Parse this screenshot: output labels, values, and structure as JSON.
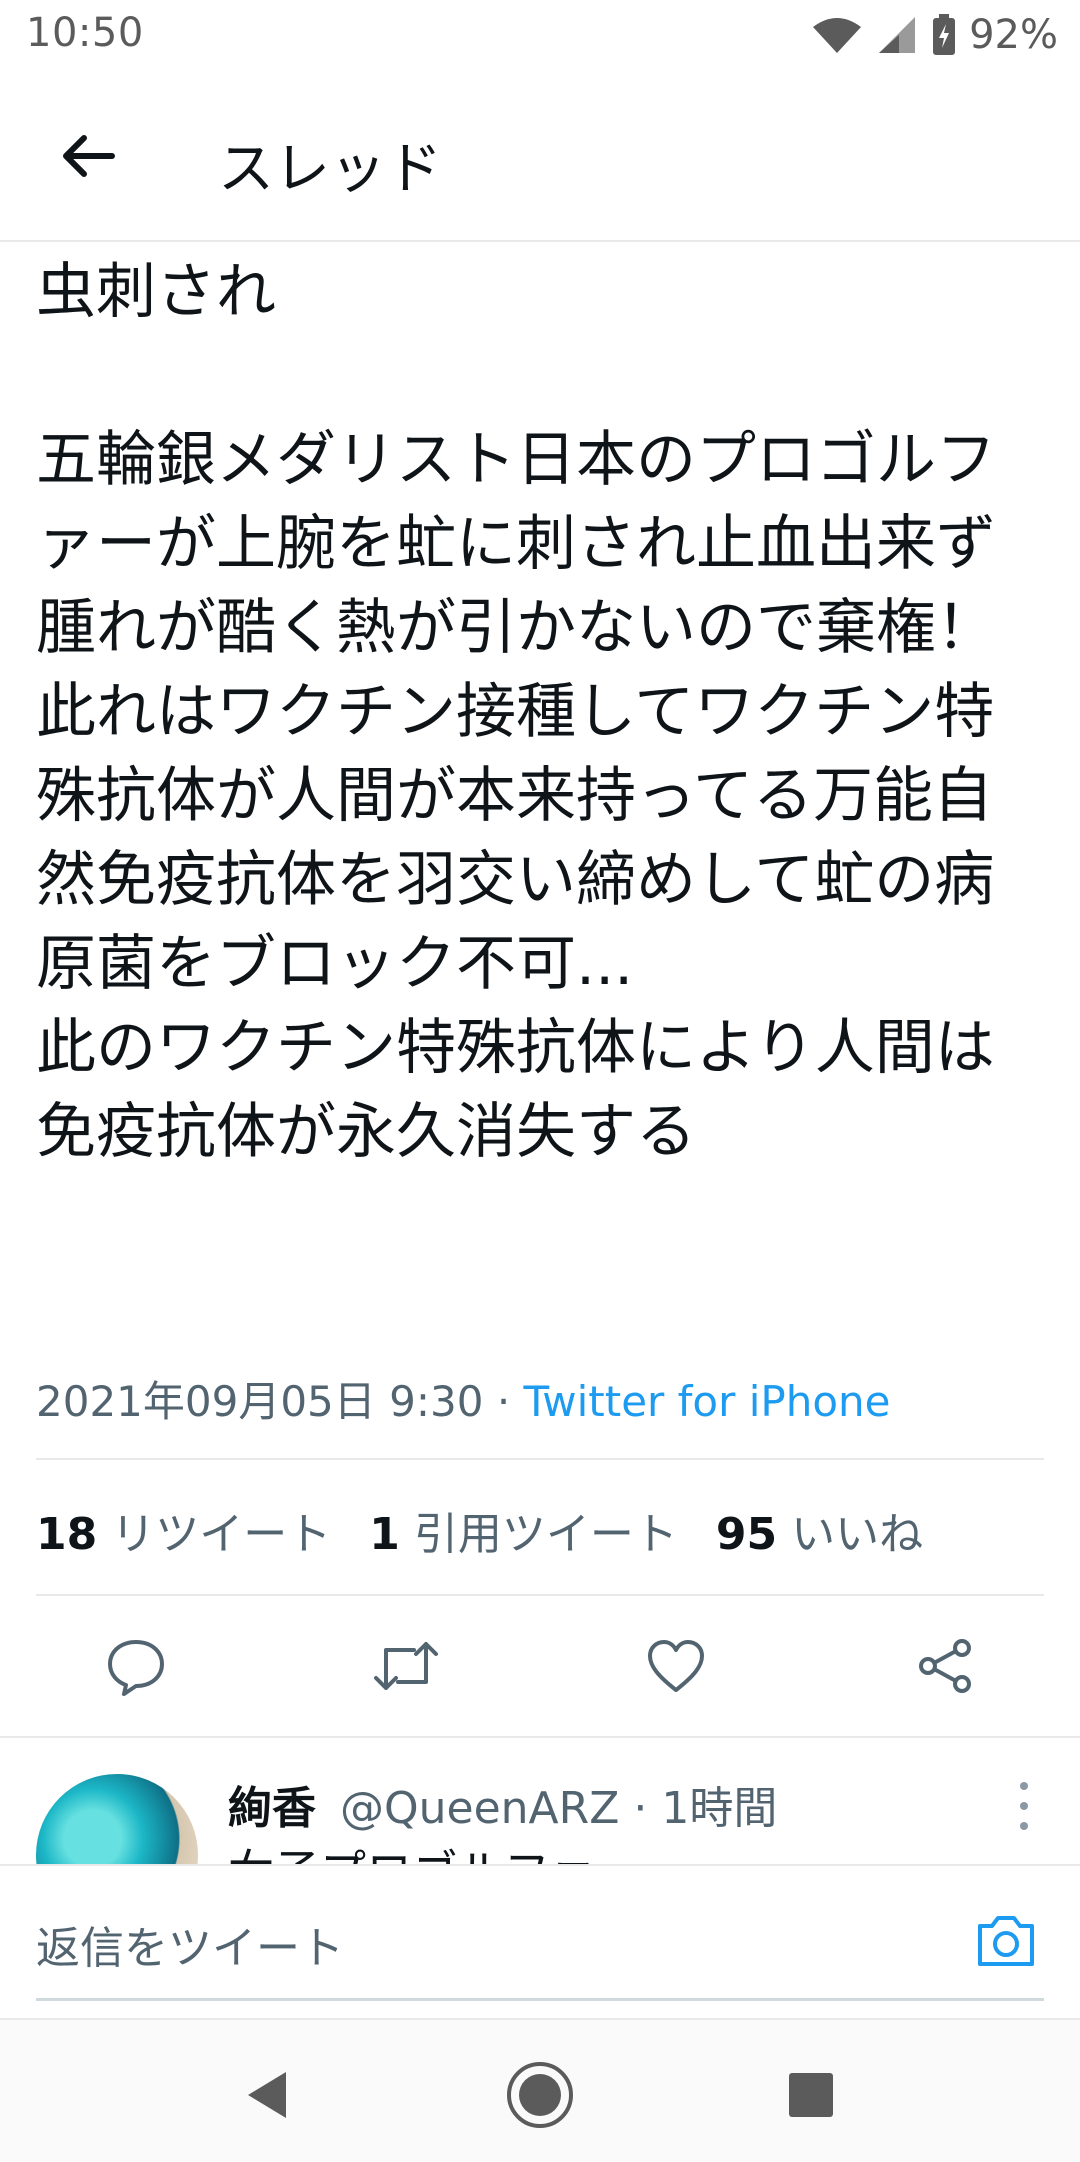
{
  "status_bar": {
    "time": "10:50",
    "battery": "92%"
  },
  "header": {
    "title": "スレッド"
  },
  "tweet": {
    "paragraphs": [
      "虫刺され",
      "",
      "五輪銀メダリスト日本のプロゴルファーが上腕を虻に刺され止血出来ず",
      "腫れが酷く熱が引かないので棄権！",
      "此れはワクチン接種してワクチン特殊抗体が人間が本来持ってる万能自然免疫抗体を羽交い締めして虻の病原菌をブロック不可...",
      "此のワクチン特殊抗体により人間は免疫抗体が永久消失する"
    ],
    "timestamp": "2021年09月05日 9:30",
    "separator": "·",
    "source": "Twitter for iPhone"
  },
  "stats": {
    "retweets_count": "18",
    "retweets_label": "リツイート",
    "quotes_count": "1",
    "quotes_label": "引用ツイート",
    "likes_count": "95",
    "likes_label": "いいね"
  },
  "reply": {
    "name": "絢香",
    "handle": "@QueenARZ",
    "time": "· 1時間",
    "text": "女子プロゴルファー"
  },
  "compose": {
    "placeholder": "返信をツイート"
  },
  "icons": {
    "back": "arrow-left-icon",
    "reply": "speech-bubble-icon",
    "retweet": "retweet-icon",
    "like": "heart-icon",
    "share": "share-icon",
    "camera": "camera-icon",
    "more": "vertical-dots-icon"
  },
  "colors": {
    "accent": "#1d9bf0",
    "text": "#0f1419",
    "secondary": "#536471"
  }
}
